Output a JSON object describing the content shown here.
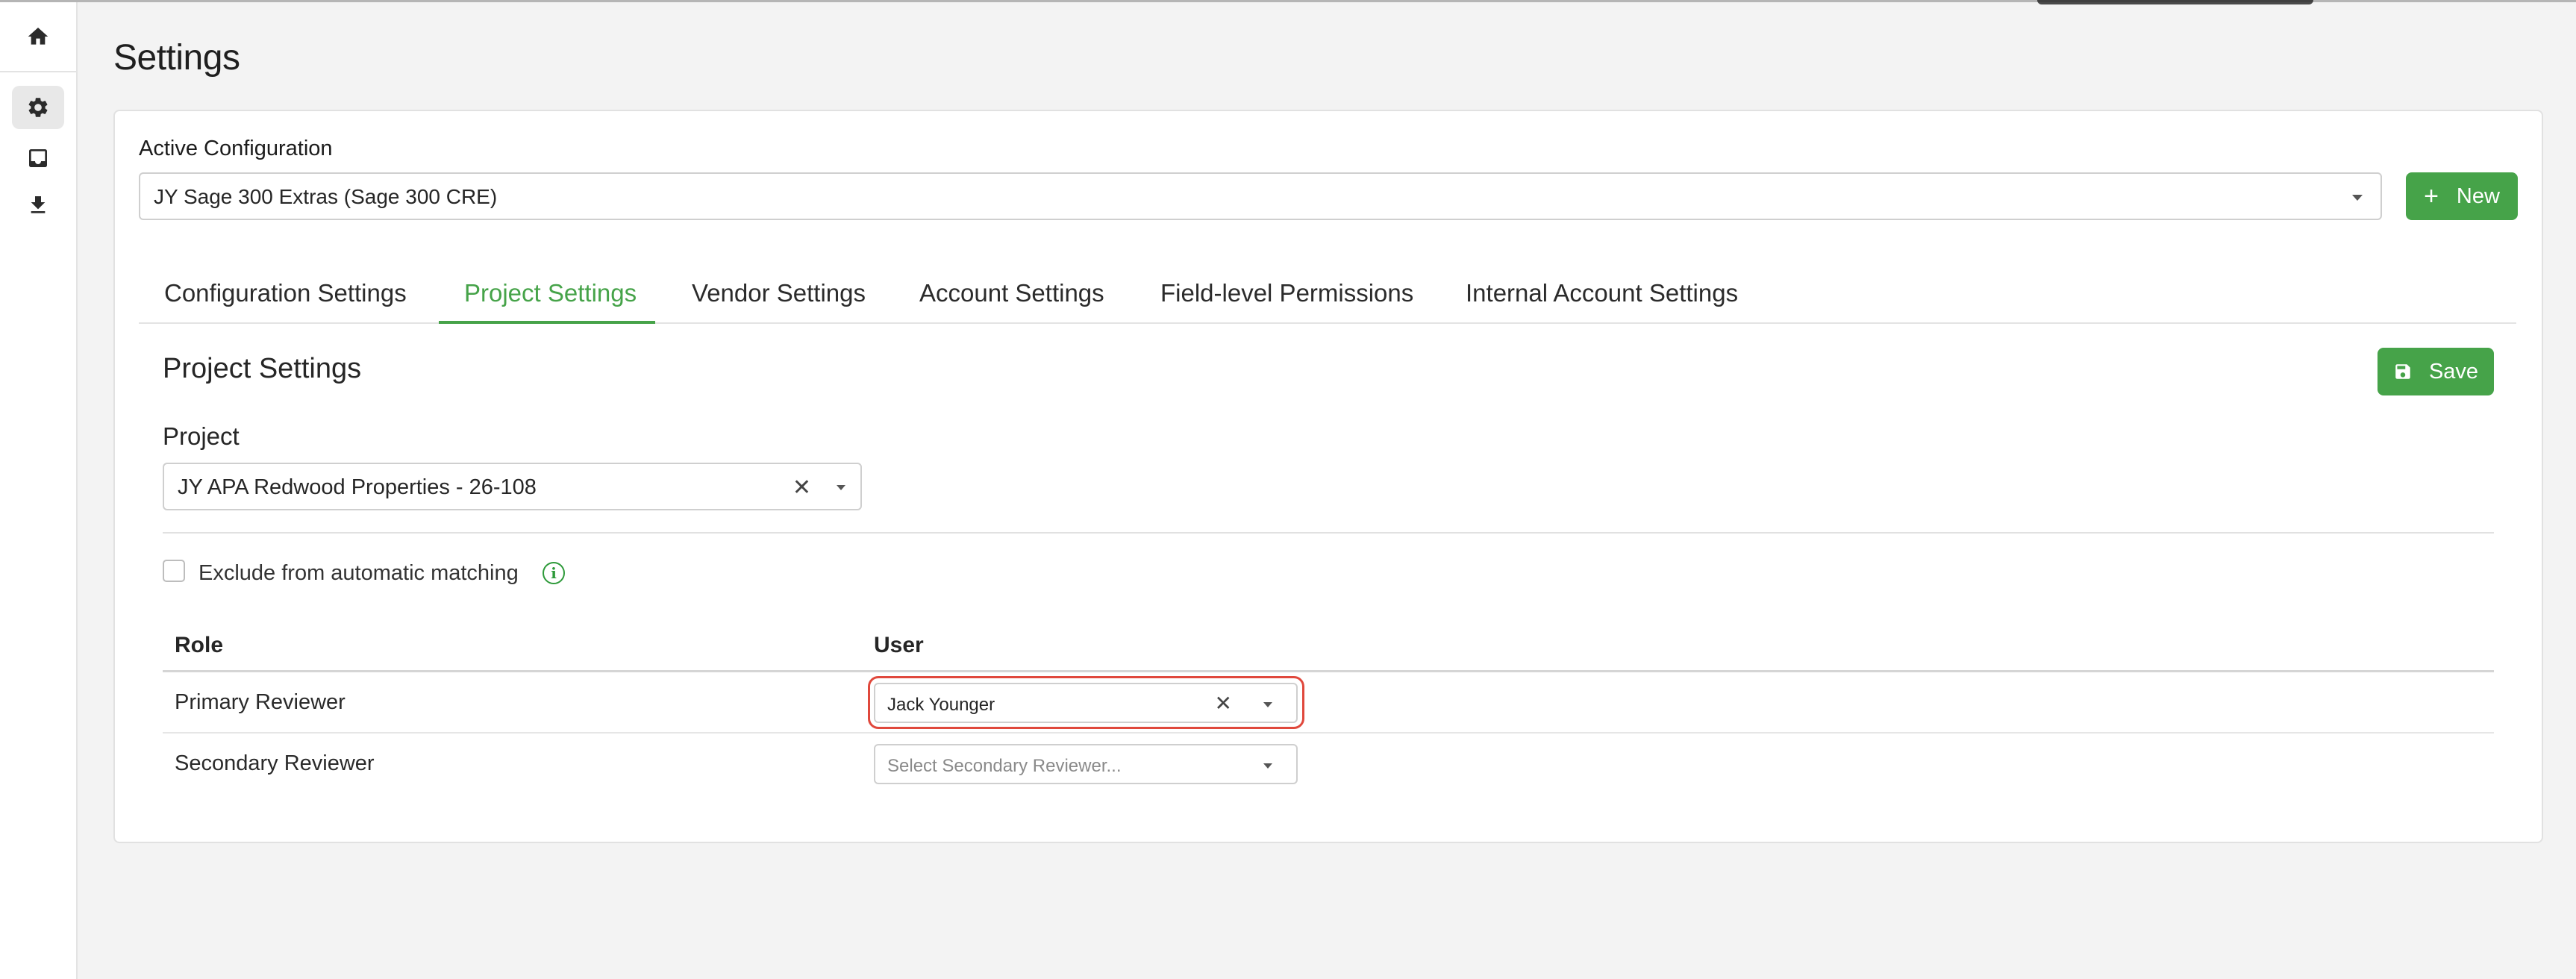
{
  "page": {
    "title": "Settings"
  },
  "sidebar": {
    "icons": [
      "home-icon",
      "gear-icon",
      "inbox-icon",
      "download-icon"
    ],
    "active": "gear-icon"
  },
  "config": {
    "label": "Active Configuration",
    "value": "JY Sage 300 Extras (Sage 300 CRE)",
    "new_button": "New"
  },
  "tabs": [
    {
      "label": "Configuration Settings",
      "active": false
    },
    {
      "label": "Project Settings",
      "active": true
    },
    {
      "label": "Vendor Settings",
      "active": false
    },
    {
      "label": "Account Settings",
      "active": false
    },
    {
      "label": "Field-level Permissions",
      "active": false
    },
    {
      "label": "Internal Account Settings",
      "active": false
    }
  ],
  "project_settings": {
    "title": "Project Settings",
    "save_button": "Save",
    "project_label": "Project",
    "project_value": "JY APA Redwood Properties - 26-108",
    "exclude_label": "Exclude from automatic matching",
    "exclude_checked": false,
    "table": {
      "headers": [
        "Role",
        "User"
      ],
      "rows": [
        {
          "role": "Primary Reviewer",
          "user": "Jack Younger",
          "placeholder": ""
        },
        {
          "role": "Secondary Reviewer",
          "user": "",
          "placeholder": "Select Secondary Reviewer..."
        }
      ]
    }
  },
  "colors": {
    "accent": "#46a349",
    "highlight": "#e0483c"
  }
}
